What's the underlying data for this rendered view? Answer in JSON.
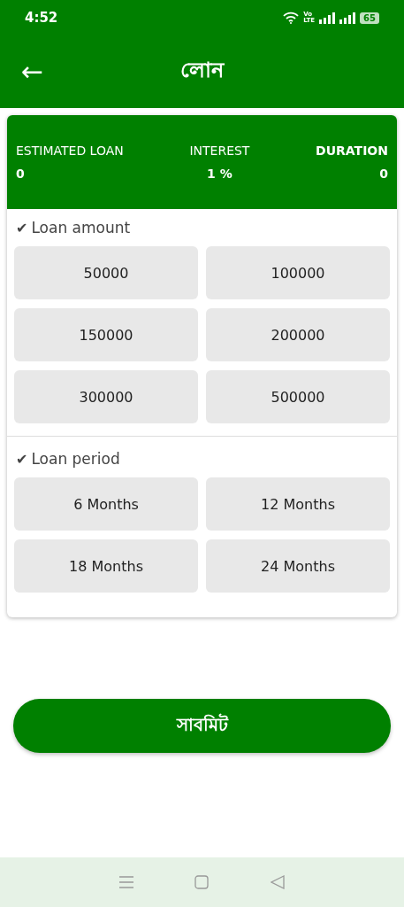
{
  "status_bar": {
    "time": "4:52",
    "network_top": "Vo",
    "network_bottom": "LTE",
    "battery": "65"
  },
  "app_bar": {
    "back_icon": "←",
    "title": "লোন"
  },
  "summary": [
    {
      "label": "ESTIMATED LOAN",
      "value": "0"
    },
    {
      "label": "INTEREST",
      "value": "1 %"
    },
    {
      "label": "DURATION",
      "value": "0"
    }
  ],
  "sections": [
    {
      "mark": "✔",
      "title": "Loan amount",
      "options": [
        {
          "label": "50000",
          "selected": false
        },
        {
          "label": "100000",
          "selected": false
        },
        {
          "label": "150000",
          "selected": false
        },
        {
          "label": "200000",
          "selected": false
        },
        {
          "label": "300000",
          "selected": false
        },
        {
          "label": "500000",
          "selected": false
        }
      ]
    },
    {
      "mark": "✔",
      "title": "Loan period",
      "options": [
        {
          "label": "6 Months",
          "selected": false
        },
        {
          "label": "12 Months",
          "selected": false
        },
        {
          "label": "18 Months",
          "selected": false
        },
        {
          "label": "24 Months",
          "selected": false
        }
      ]
    }
  ],
  "submit": "সাবমিট"
}
